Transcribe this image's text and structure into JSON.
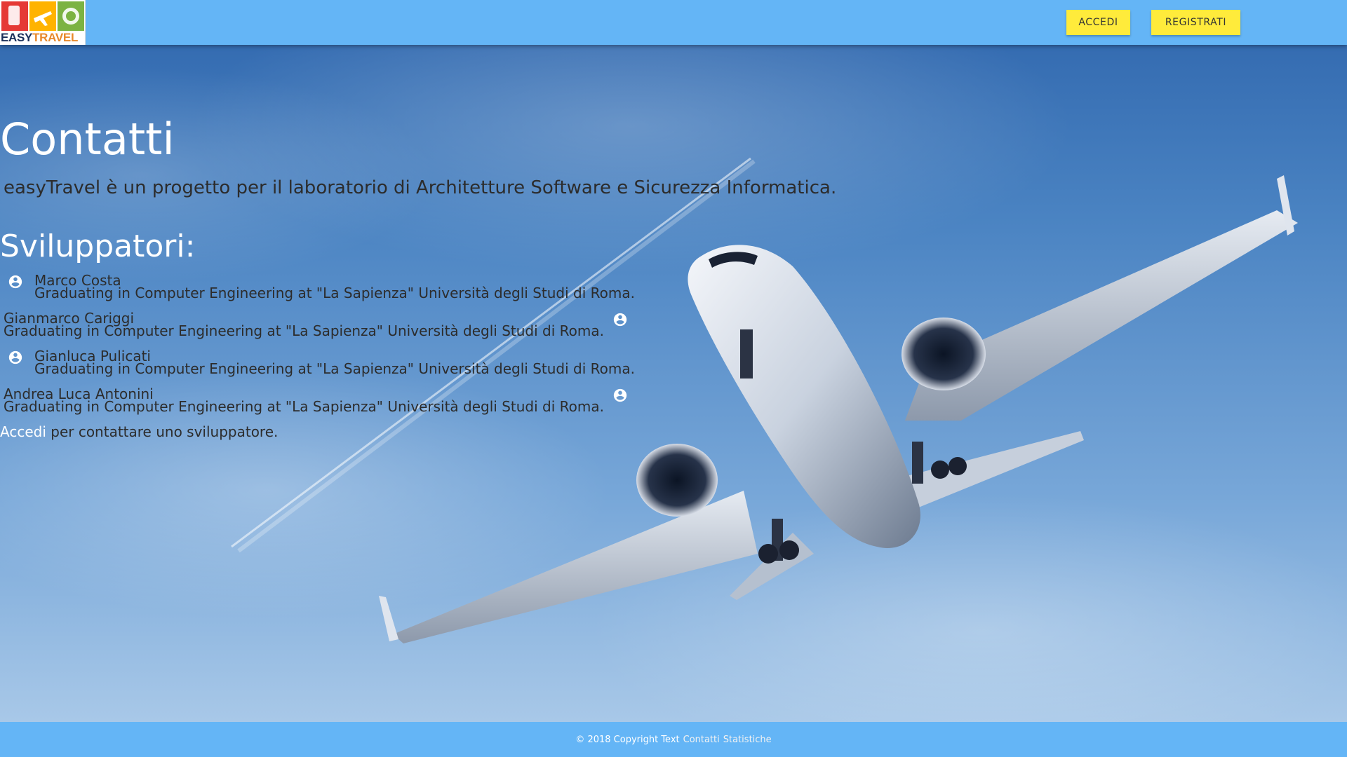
{
  "nav": {
    "logo_text_part1": "EASY",
    "logo_text_part2": "TRAVEL",
    "login_label": "ACCEDI",
    "register_label": "REGISTRATI"
  },
  "main": {
    "title": "Contatti",
    "intro": "easyTravel è un progetto per il laboratorio di Architetture Software e Sicurezza Informatica.",
    "developers_heading": "Sviluppatori:",
    "developers": [
      {
        "name": "Marco Costa",
        "description": "Graduating in Computer Engineering at \"La Sapienza\" Università degli Studi di Roma."
      },
      {
        "name": "Gianmarco Cariggi",
        "description": "Graduating in Computer Engineering at \"La Sapienza\" Università degli Studi di Roma."
      },
      {
        "name": "Gianluca Pulicati",
        "description": "Graduating in Computer Engineering at \"La Sapienza\" Università degli Studi di Roma."
      },
      {
        "name": "Andrea Luca Antonini",
        "description": "Graduating in Computer Engineering at \"La Sapienza\" Università degli Studi di Roma."
      }
    ],
    "contact_link": "Accedi",
    "contact_text": " per contattare uno sviluppatore."
  },
  "footer": {
    "copyright": "© 2018 Copyright Text",
    "links": [
      "Contatti",
      "Statistiche"
    ]
  },
  "colors": {
    "navbar": "#64b5f6",
    "button": "#ffeb3b",
    "link": "#ffffff"
  },
  "icons": [
    "account-circle-icon"
  ]
}
